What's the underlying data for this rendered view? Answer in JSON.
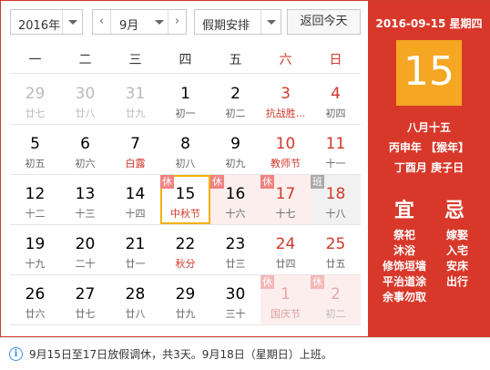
{
  "toolbar": {
    "year": "2016年",
    "month": "9月",
    "holiday": "假期安排",
    "today": "返回今天"
  },
  "weekdays": [
    "一",
    "二",
    "三",
    "四",
    "五",
    "六",
    "日"
  ],
  "weeks": [
    [
      {
        "day": "29",
        "sub": "廿七",
        "other": true
      },
      {
        "day": "30",
        "sub": "廿八",
        "other": true
      },
      {
        "day": "31",
        "sub": "廿九",
        "other": true
      },
      {
        "day": "1",
        "sub": "初一"
      },
      {
        "day": "2",
        "sub": "初二"
      },
      {
        "day": "3",
        "sub": "抗战胜...",
        "weekend": true,
        "fest": true
      },
      {
        "day": "4",
        "sub": "初四",
        "weekend": true
      }
    ],
    [
      {
        "day": "5",
        "sub": "初五"
      },
      {
        "day": "6",
        "sub": "初六"
      },
      {
        "day": "7",
        "sub": "白露",
        "fest": true
      },
      {
        "day": "8",
        "sub": "初八"
      },
      {
        "day": "9",
        "sub": "初九"
      },
      {
        "day": "10",
        "sub": "教师节",
        "weekend": true,
        "fest": true
      },
      {
        "day": "11",
        "sub": "十一",
        "weekend": true
      }
    ],
    [
      {
        "day": "12",
        "sub": "十二"
      },
      {
        "day": "13",
        "sub": "十三"
      },
      {
        "day": "14",
        "sub": "十四"
      },
      {
        "day": "15",
        "sub": "中秋节",
        "fest": true,
        "tag": "休",
        "today": true
      },
      {
        "day": "16",
        "sub": "十六",
        "tag": "休"
      },
      {
        "day": "17",
        "sub": "十七",
        "weekend": true,
        "tag": "休"
      },
      {
        "day": "18",
        "sub": "十八",
        "weekend": true,
        "tag": "班",
        "work": true
      }
    ],
    [
      {
        "day": "19",
        "sub": "十九"
      },
      {
        "day": "20",
        "sub": "二十"
      },
      {
        "day": "21",
        "sub": "廿一"
      },
      {
        "day": "22",
        "sub": "秋分",
        "fest": true
      },
      {
        "day": "23",
        "sub": "廿三"
      },
      {
        "day": "24",
        "sub": "廿四",
        "weekend": true
      },
      {
        "day": "25",
        "sub": "廿五",
        "weekend": true
      }
    ],
    [
      {
        "day": "26",
        "sub": "廿六"
      },
      {
        "day": "27",
        "sub": "廿七"
      },
      {
        "day": "28",
        "sub": "廿八"
      },
      {
        "day": "29",
        "sub": "廿九"
      },
      {
        "day": "30",
        "sub": "三十"
      },
      {
        "day": "1",
        "sub": "国庆节",
        "other": true,
        "weekend": true,
        "fest": true,
        "tag": "休"
      },
      {
        "day": "2",
        "sub": "初二",
        "other": true,
        "weekend": true,
        "tag": "休"
      }
    ]
  ],
  "panel": {
    "date_line": "2016-09-15 星期四",
    "big_day": "15",
    "lunar_date": "八月十五",
    "ganzhi_year": "丙申年 【猴年】",
    "ganzhi_month": "丁酉月 庚子日",
    "yi_title": "宜",
    "ji_title": "忌",
    "yi": [
      "祭祀",
      "沐浴",
      "修饰垣墙",
      "平治道涂",
      "余事勿取"
    ],
    "ji": [
      "嫁娶",
      "入宅",
      "安床",
      "出行"
    ]
  },
  "notice": "9月15日至17日放假调休，共3天。9月18日（星期日）上班。",
  "colors": {
    "accent_red": "#d8382a",
    "today_box": "#f5a623",
    "today_outline": "#f2b100"
  }
}
